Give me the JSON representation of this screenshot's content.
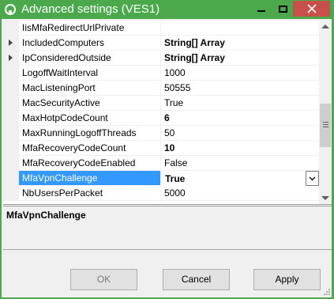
{
  "window": {
    "title": "Advanced settings (VES1)",
    "accent_color": "#4ba84b",
    "close_color": "#c7514a",
    "selection_color": "#3399ff"
  },
  "titlebar_icons": {
    "app": "app-icon",
    "minimize": "minimize-icon",
    "maximize": "maximize-icon",
    "close": "close-icon"
  },
  "properties": [
    {
      "name": "IisMfaRedirectUrlPrivate",
      "value": "",
      "bold": false,
      "expandable": false,
      "selected": false
    },
    {
      "name": "IncludedComputers",
      "value": "String[] Array",
      "bold": true,
      "expandable": true,
      "selected": false
    },
    {
      "name": "IpConsideredOutside",
      "value": "String[] Array",
      "bold": true,
      "expandable": true,
      "selected": false
    },
    {
      "name": "LogoffWaitInterval",
      "value": "1000",
      "bold": false,
      "expandable": false,
      "selected": false
    },
    {
      "name": "MacListeningPort",
      "value": "50555",
      "bold": false,
      "expandable": false,
      "selected": false
    },
    {
      "name": "MacSecurityActive",
      "value": "True",
      "bold": false,
      "expandable": false,
      "selected": false
    },
    {
      "name": "MaxHotpCodeCount",
      "value": "6",
      "bold": true,
      "expandable": false,
      "selected": false
    },
    {
      "name": "MaxRunningLogoffThreads",
      "value": "50",
      "bold": false,
      "expandable": false,
      "selected": false
    },
    {
      "name": "MfaRecoveryCodeCount",
      "value": "10",
      "bold": true,
      "expandable": false,
      "selected": false
    },
    {
      "name": "MfaRecoveryCodeEnabled",
      "value": "False",
      "bold": false,
      "expandable": false,
      "selected": false
    },
    {
      "name": "MfaVpnChallenge",
      "value": "True",
      "bold": true,
      "expandable": false,
      "selected": true
    },
    {
      "name": "NbUsersPerPacket",
      "value": "5000",
      "bold": false,
      "expandable": false,
      "selected": false
    }
  ],
  "help": {
    "title": "MfaVpnChallenge",
    "description": ""
  },
  "buttons": {
    "ok": "OK",
    "cancel": "Cancel",
    "apply": "Apply"
  }
}
